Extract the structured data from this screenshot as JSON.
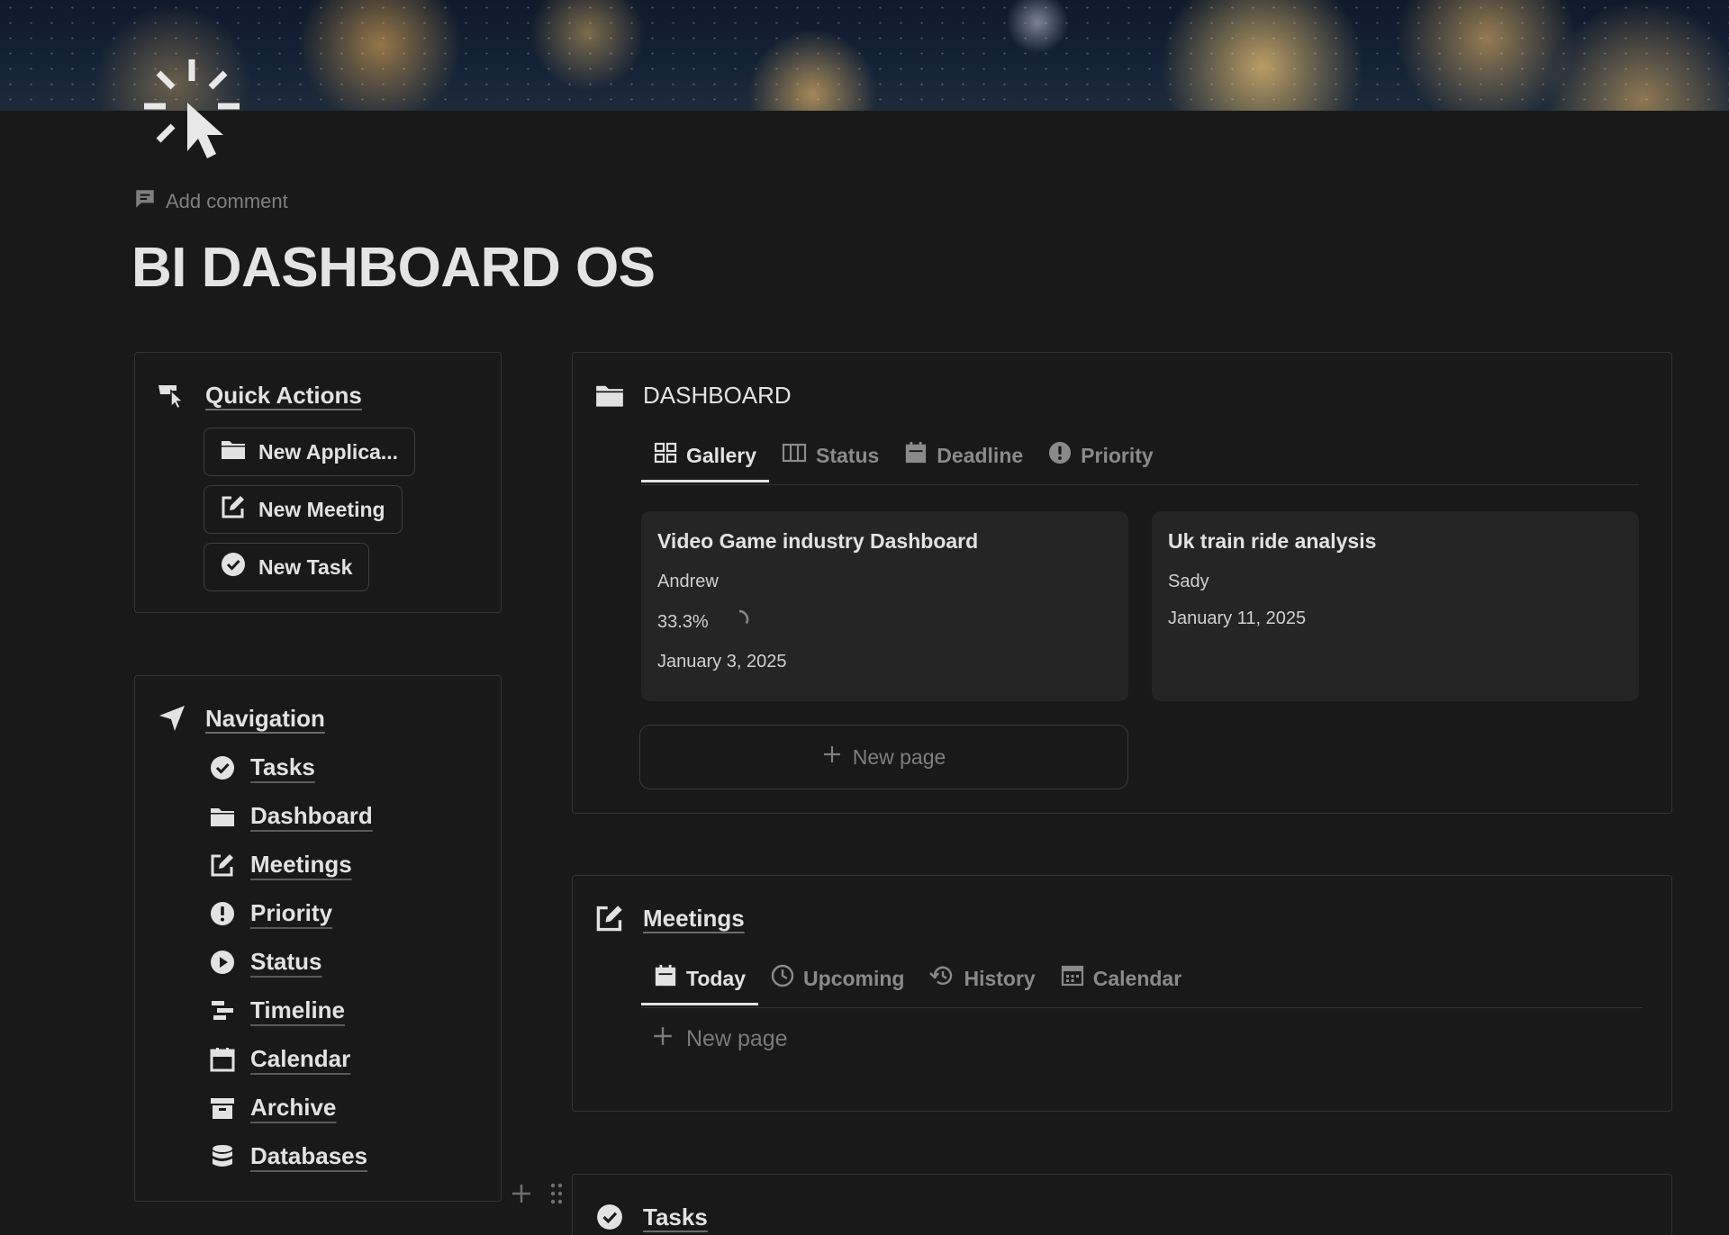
{
  "page": {
    "title": "BI DASHBOARD OS",
    "add_comment_label": "Add comment",
    "icon": "cursor-click-icon"
  },
  "quick_actions": {
    "title": "Quick Actions",
    "icon": "hand-pointer-icon",
    "buttons": [
      {
        "label": "New Applica...",
        "icon": "folder-icon"
      },
      {
        "label": "New Meeting",
        "icon": "edit-square-icon"
      },
      {
        "label": "New Task",
        "icon": "check-circle-icon"
      }
    ]
  },
  "navigation": {
    "title": "Navigation",
    "icon": "navigation-arrow-icon",
    "items": [
      {
        "label": "Tasks",
        "icon": "check-circle-icon"
      },
      {
        "label": "Dashboard",
        "icon": "folder-icon"
      },
      {
        "label": "Meetings",
        "icon": "edit-square-icon"
      },
      {
        "label": "Priority",
        "icon": "exclamation-circle-icon"
      },
      {
        "label": "Status",
        "icon": "play-circle-icon"
      },
      {
        "label": "Timeline",
        "icon": "timeline-icon"
      },
      {
        "label": "Calendar",
        "icon": "calendar-icon"
      },
      {
        "label": "Archive",
        "icon": "archive-icon"
      },
      {
        "label": "Databases",
        "icon": "database-icon"
      }
    ]
  },
  "dashboard": {
    "title": "DASHBOARD",
    "icon": "folder-icon",
    "tabs": [
      {
        "label": "Gallery",
        "icon": "gallery-icon",
        "active": true
      },
      {
        "label": "Status",
        "icon": "columns-icon",
        "active": false
      },
      {
        "label": "Deadline",
        "icon": "calendar-icon",
        "active": false
      },
      {
        "label": "Priority",
        "icon": "exclamation-circle-icon",
        "active": false
      }
    ],
    "cards": [
      {
        "title": "Video Game industry Dashboard",
        "owner": "Andrew",
        "progress": "33.3%",
        "progress_fraction": 0.333,
        "date": "January 3, 2025"
      },
      {
        "title": "Uk train ride analysis",
        "owner": "Sady",
        "date": "January 11, 2025"
      }
    ],
    "new_page_label": "New page"
  },
  "meetings": {
    "title": "Meetings",
    "icon": "edit-square-icon",
    "tabs": [
      {
        "label": "Today",
        "icon": "calendar-icon",
        "active": true
      },
      {
        "label": "Upcoming",
        "icon": "clock-icon",
        "active": false
      },
      {
        "label": "History",
        "icon": "history-icon",
        "active": false
      },
      {
        "label": "Calendar",
        "icon": "calendar-grid-icon",
        "active": false
      }
    ],
    "new_page_label": "New page"
  },
  "tasks": {
    "title": "Tasks",
    "icon": "check-circle-icon"
  }
}
